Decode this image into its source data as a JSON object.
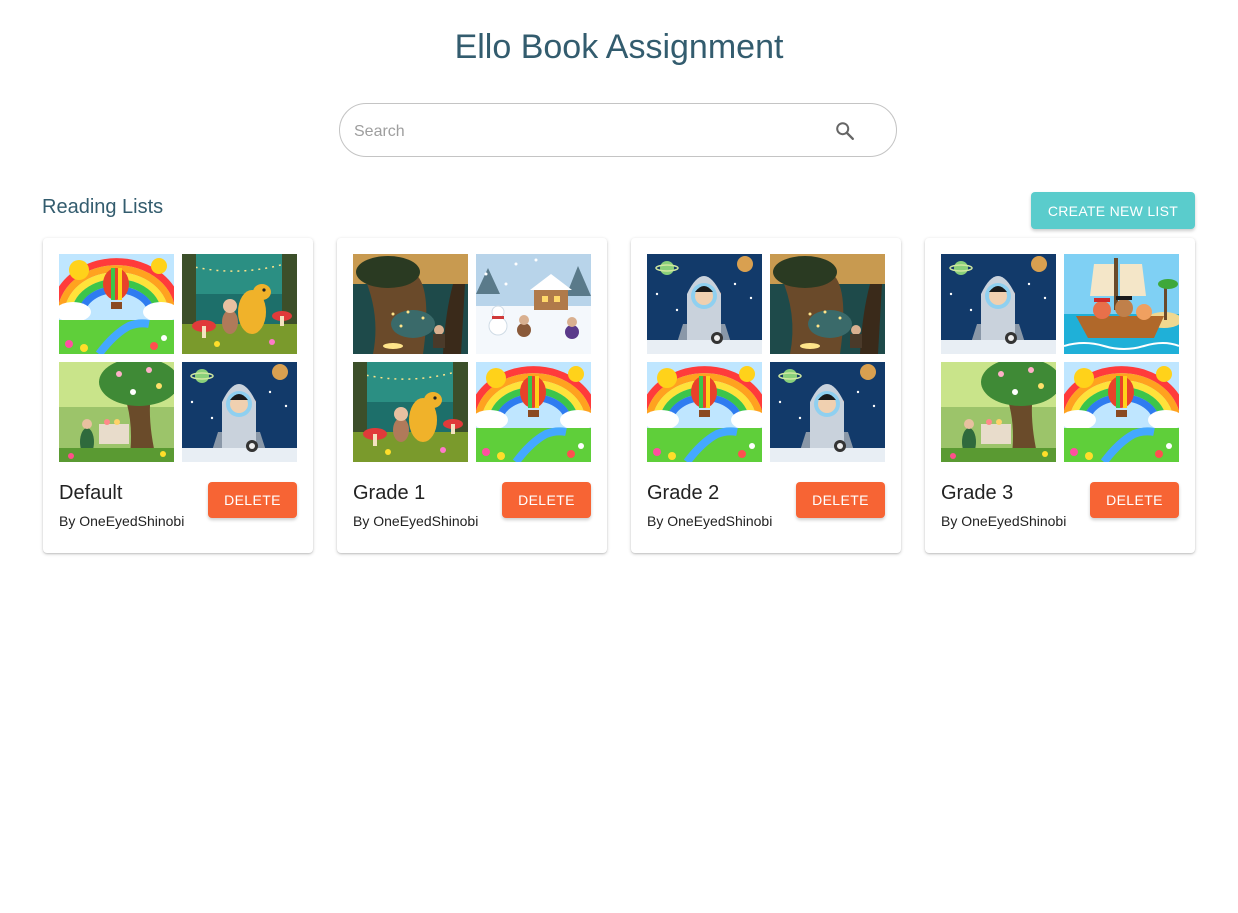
{
  "header": {
    "title": "Ello Book Assignment"
  },
  "search": {
    "placeholder": "Search",
    "value": "",
    "icon": "search-icon"
  },
  "section": {
    "title": "Reading Lists",
    "create_label": "CREATE NEW LIST"
  },
  "colors": {
    "title": "#335c6e",
    "accent_teal": "#5acccc",
    "delete_orange": "#f76434"
  },
  "lists": [
    {
      "name": "Default",
      "author": "By OneEyedShinobi",
      "delete_label": "DELETE",
      "covers": [
        "rainbow-balloon",
        "forest-dragon",
        "fairy-tree",
        "space-rocket"
      ]
    },
    {
      "name": "Grade 1",
      "author": "By OneEyedShinobi",
      "delete_label": "DELETE",
      "covers": [
        "dark-tree",
        "snow-village",
        "forest-dragon",
        "rainbow-balloon"
      ]
    },
    {
      "name": "Grade 2",
      "author": "By OneEyedShinobi",
      "delete_label": "DELETE",
      "covers": [
        "space-rocket",
        "dark-tree",
        "rainbow-balloon",
        "space-rocket"
      ]
    },
    {
      "name": "Grade 3",
      "author": "By OneEyedShinobi",
      "delete_label": "DELETE",
      "covers": [
        "space-rocket",
        "pirate-boat",
        "fairy-tree",
        "rainbow-balloon"
      ]
    }
  ]
}
